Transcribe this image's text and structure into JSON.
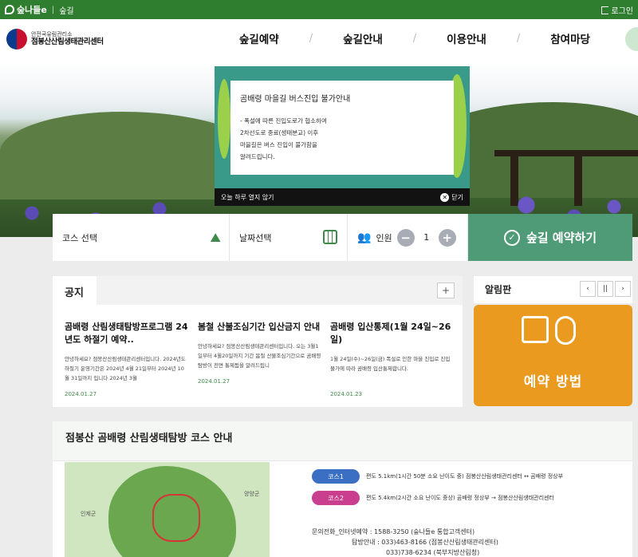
{
  "topbar": {
    "logo": "숲나들e",
    "section": "숲길",
    "login": "로그인"
  },
  "header": {
    "org_line1": "안전국유림관리소",
    "org_line2": "점봉산산림생태관리센터",
    "nav": [
      "숲길예약",
      "숲길안내",
      "이용안내",
      "참여마당"
    ]
  },
  "popup": {
    "title": "곰배령 마을길 버스진입 불가안내",
    "lines": [
      "- 폭설에 따른 진입도로가 협소하여",
      "2차선도로 종료(생태분교) 이후",
      "마을길은 버스 진입이 불가함을",
      "알려드립니다."
    ],
    "no_show_today": "오늘 하루 열지 않기",
    "close": "닫기"
  },
  "booking": {
    "course_label": "코스 선택",
    "date_label": "날짜선택",
    "people_label": "인원",
    "people_count": "1",
    "minus": "−",
    "plus": "+",
    "submit": "숲길 예약하기"
  },
  "notice": {
    "tab": "공지",
    "more": "+",
    "posts": [
      {
        "title": "곰배령 산림생태탐방프로그램 24년도 하절기 예약..",
        "body": "안녕하세요? 점봉산산림생태관리센터입니다. 2024년도 하절기 운영기간은 2024년 4월 21일부터 2024년 10월 31일까지 입니다 2024년 3월",
        "date": "2024.01.27"
      },
      {
        "title": "봄철 산불조심기간 입산금지 안내",
        "body": "안녕하세요? 점봉산산림생태관리센터입니다. 오는 3월1일부터 4월20일까지 기간 봄철 산불조심기간으로 곰배령 탐방이 전면 통제됨을 알려드립니",
        "date": "2024.01.27"
      },
      {
        "title": "곰배령 입산통제(1월 24일~26일)",
        "body": "1월 24일(수)~26일(금) 폭설로 인한 마을 진입로 진입불가에 따라 곰배령 입산통제합니다.",
        "date": "2024.01.23"
      }
    ]
  },
  "bulletin": {
    "title": "알림판",
    "prev": "‹",
    "pause": "||",
    "next": "›",
    "banner_label": "예약 방법"
  },
  "guide": {
    "title": "점봉산 곰배령 산림생태탐방 코스 안내",
    "map_labels": [
      "인제군",
      "양양군"
    ],
    "courses": [
      {
        "name": "코스1",
        "desc": "편도 5.1km(1시간 50분 소요 난이도 중) 점봉산산림생태관리센터 ↔ 곰배령 정상부",
        "color": "#3a6fc4"
      },
      {
        "name": "코스2",
        "desc": "편도 5.4km(2시간 소요 난이도 중상) 곰배령 정상부 → 점봉산산림생태관리센터",
        "color": "#c93e8e"
      }
    ],
    "contact_lines": [
      "문의전화_인터넷예약 : 1588-3250 (숲나들e 통합고객센터)",
      "탐방안내 : 033)463-8166 (점봉산산림생태관리센터)",
      "033)738-6234 (북부지방산림청)"
    ]
  },
  "colors": {
    "topbar": "#2f7d2f",
    "submit": "#4f9a77",
    "banner": "#ea9a1f"
  }
}
